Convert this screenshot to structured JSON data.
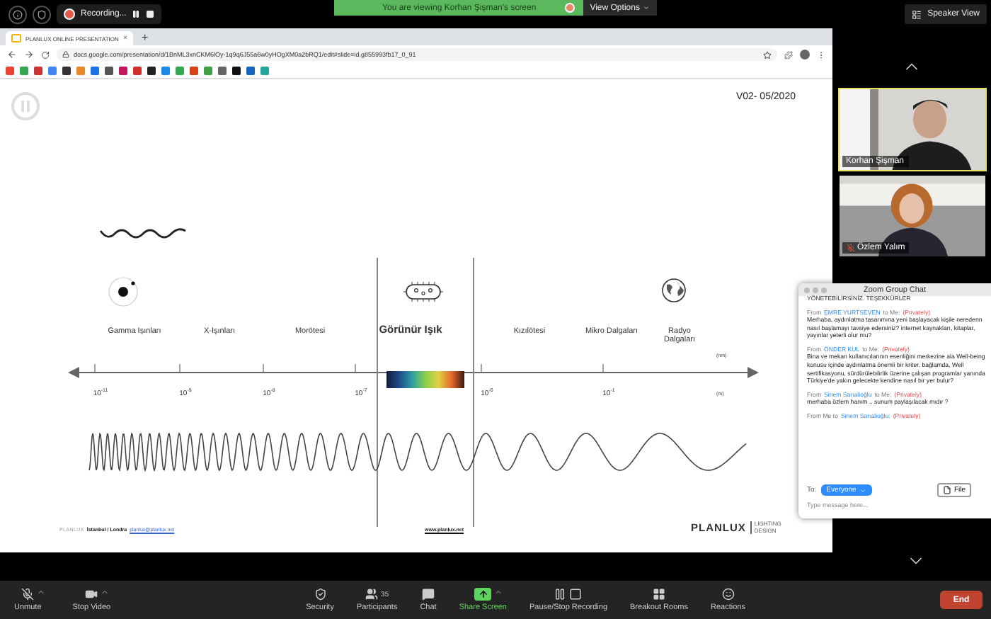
{
  "top_bar": {
    "recording": "Recording...",
    "banner": "You are viewing Korhan Şişman's screen",
    "view_options": "View Options",
    "speaker_view": "Speaker View"
  },
  "browser": {
    "tab": "PLANLUX ONLINE PRESENTATION",
    "tab_close": "×",
    "new_tab": "+",
    "address": "docs.google.com/presentation/d/1BnML3xnCKM6lOy-1q9q6J55a6w0yHOgXM0a2bRQ1/edit#slide=id.g855993fb17_0_91"
  },
  "slide": {
    "version": "V02- 05/2020",
    "bands": [
      {
        "label": "Gamma Işınları",
        "highlighted": false
      },
      {
        "label": "X-Işınları",
        "highlighted": false
      },
      {
        "label": "Morötesi",
        "highlighted": false
      },
      {
        "label": "Görünür Işık",
        "highlighted": true
      },
      {
        "label": "Kızılötesi",
        "highlighted": false
      },
      {
        "label": "Mikro Dalgaları",
        "highlighted": false
      },
      {
        "label": "Radyo Dalgaları",
        "highlighted": false
      }
    ],
    "ticks": [
      "10$^{-11}$",
      "10$^{-9}$",
      "10$^{-8}$",
      "10$^{-7}$",
      "10$^{-6}$",
      "10$^{-1}$"
    ],
    "unit_top": "(nm)",
    "unit_bottom": "(m)",
    "footer": {
      "brand": "PLANLUX",
      "cities": "İstanbul / Londra",
      "email": "planlux@planlux.net",
      "website": "www.planlux.net",
      "logo": "PLANLUX",
      "logo_sub": "LIGHTING DESIGN"
    }
  },
  "videos": [
    {
      "name": "Korhan Şişman",
      "active": true,
      "muted": false
    },
    {
      "name": "Özlem Yalım",
      "active": false,
      "muted": true
    }
  ],
  "chat": {
    "title": "Zoom Group Chat",
    "top_line": "YÖNETEBİLİRSİNİZ. TEŞEKKÜRLER",
    "messages": [
      {
        "prefix": "From",
        "name": "EMRE YURTSEVEN",
        "suffix": "to Me:",
        "privacy": "(Privately)",
        "text": "Merhaba, aydınlatma tasarımına yeni başlayacak kişile neredenn nasıl başlamayı tavsiye edersiniz? internet kaynakları, kitaplar, yayınlar yeterli olur mu?"
      },
      {
        "prefix": "From",
        "name": "ÖNDER KUL",
        "suffix": "to Me:",
        "privacy": "(Privately)",
        "text": "Bina ve mekan kullanıcılarının esenliğini merkezine ala Well-being konusu içinde aydınlatma önemli bir kriter. bağlamda, Well sertifikasyonu, sürdürülebilirlik üzerine çalışan programlar yanında Türkiye'de yakın gelecekte kendine nasıl bir yer bulur?"
      },
      {
        "prefix": "From",
        "name": "Sinem Sarıalioğlu",
        "suffix": "to Me:",
        "privacy": "(Privately)",
        "text": "merhaba özlem hanım .. sunum paylaşılacak mıdır ?"
      },
      {
        "prefix": "From Me to",
        "name": "Sinem Sarıalioğlu:",
        "privacy": "(Privately)"
      }
    ],
    "to_label": "To:",
    "recipient": "Everyone",
    "file": "File",
    "placeholder": "Type message here..."
  },
  "toolbar": {
    "items": [
      {
        "kind": "mic",
        "label": "Unmute",
        "muted": true,
        "menu": true
      },
      {
        "kind": "video",
        "label": "Stop Video",
        "menu": true
      },
      {
        "kind": "security",
        "label": "Security"
      },
      {
        "kind": "participants",
        "label": "Participants",
        "count": "35"
      },
      {
        "kind": "chat",
        "label": "Chat"
      },
      {
        "kind": "share",
        "label": "Share Screen",
        "active": true,
        "menu": true
      },
      {
        "kind": "recording",
        "label": "Pause/Stop Recording"
      },
      {
        "kind": "breakout",
        "label": "Breakout Rooms"
      },
      {
        "kind": "reactions",
        "label": "Reactions"
      }
    ],
    "end": "End"
  }
}
